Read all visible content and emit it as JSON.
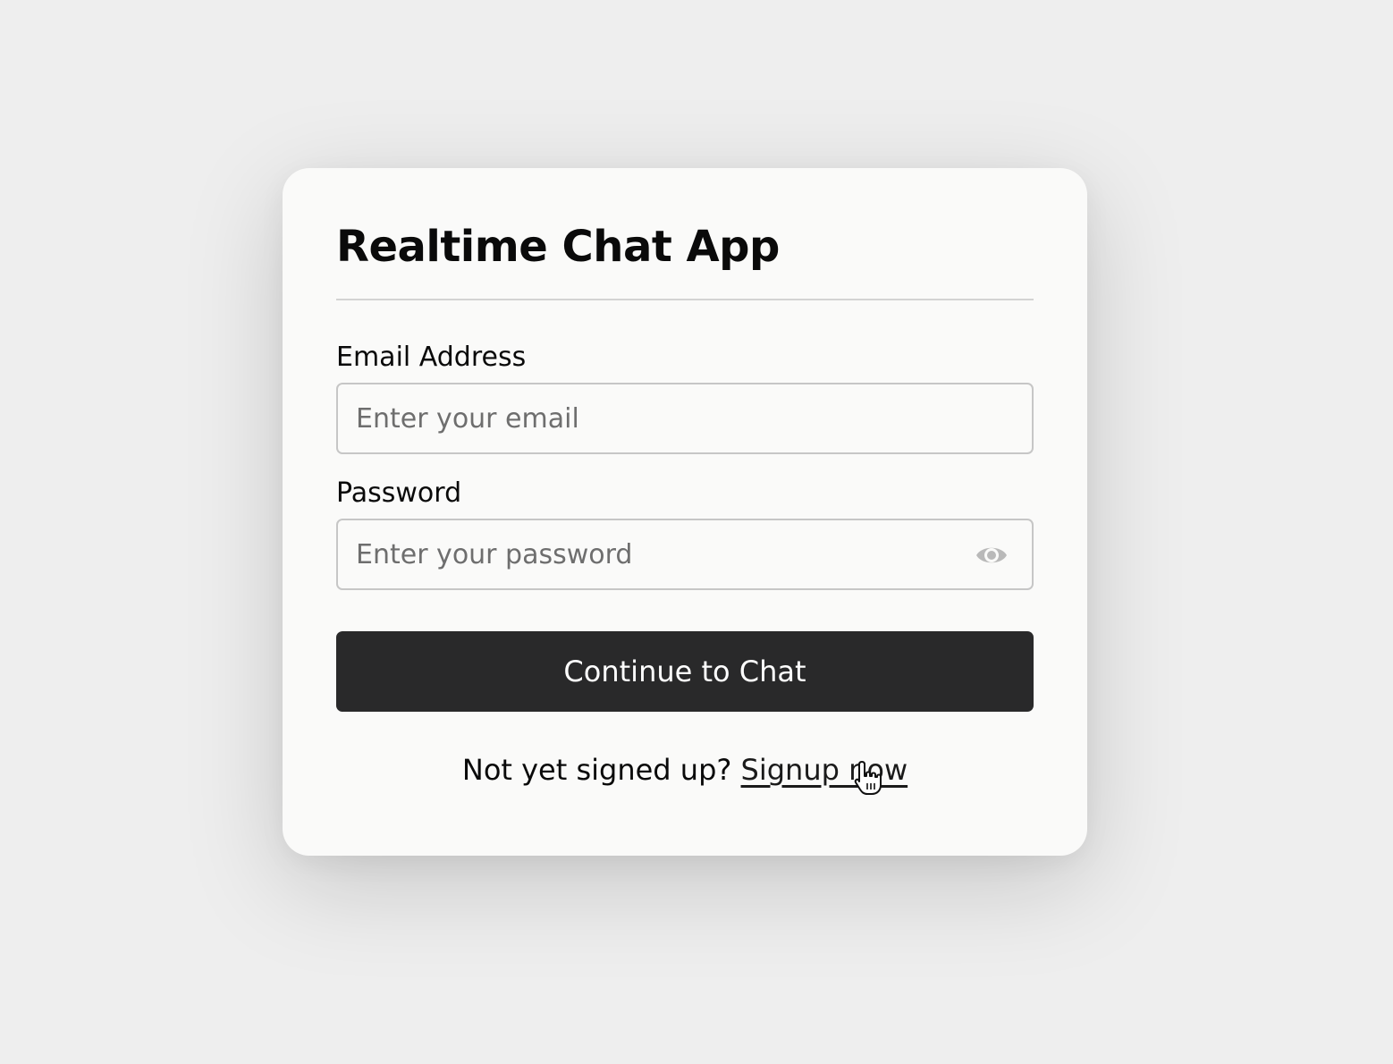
{
  "app": {
    "title": "Realtime Chat App"
  },
  "form": {
    "email_label": "Email Address",
    "email_placeholder": "Enter your email",
    "email_value": "",
    "password_label": "Password",
    "password_placeholder": "Enter your password",
    "password_value": "",
    "password_toggle_icon": "eye-icon",
    "submit_label": "Continue to Chat"
  },
  "footer": {
    "prompt": "Not yet signed up?",
    "link_label": "Signup now"
  },
  "theme": {
    "background": "#eeeeee",
    "card": "#fafaf9",
    "button": "#29292a",
    "button_text": "#ffffff"
  }
}
